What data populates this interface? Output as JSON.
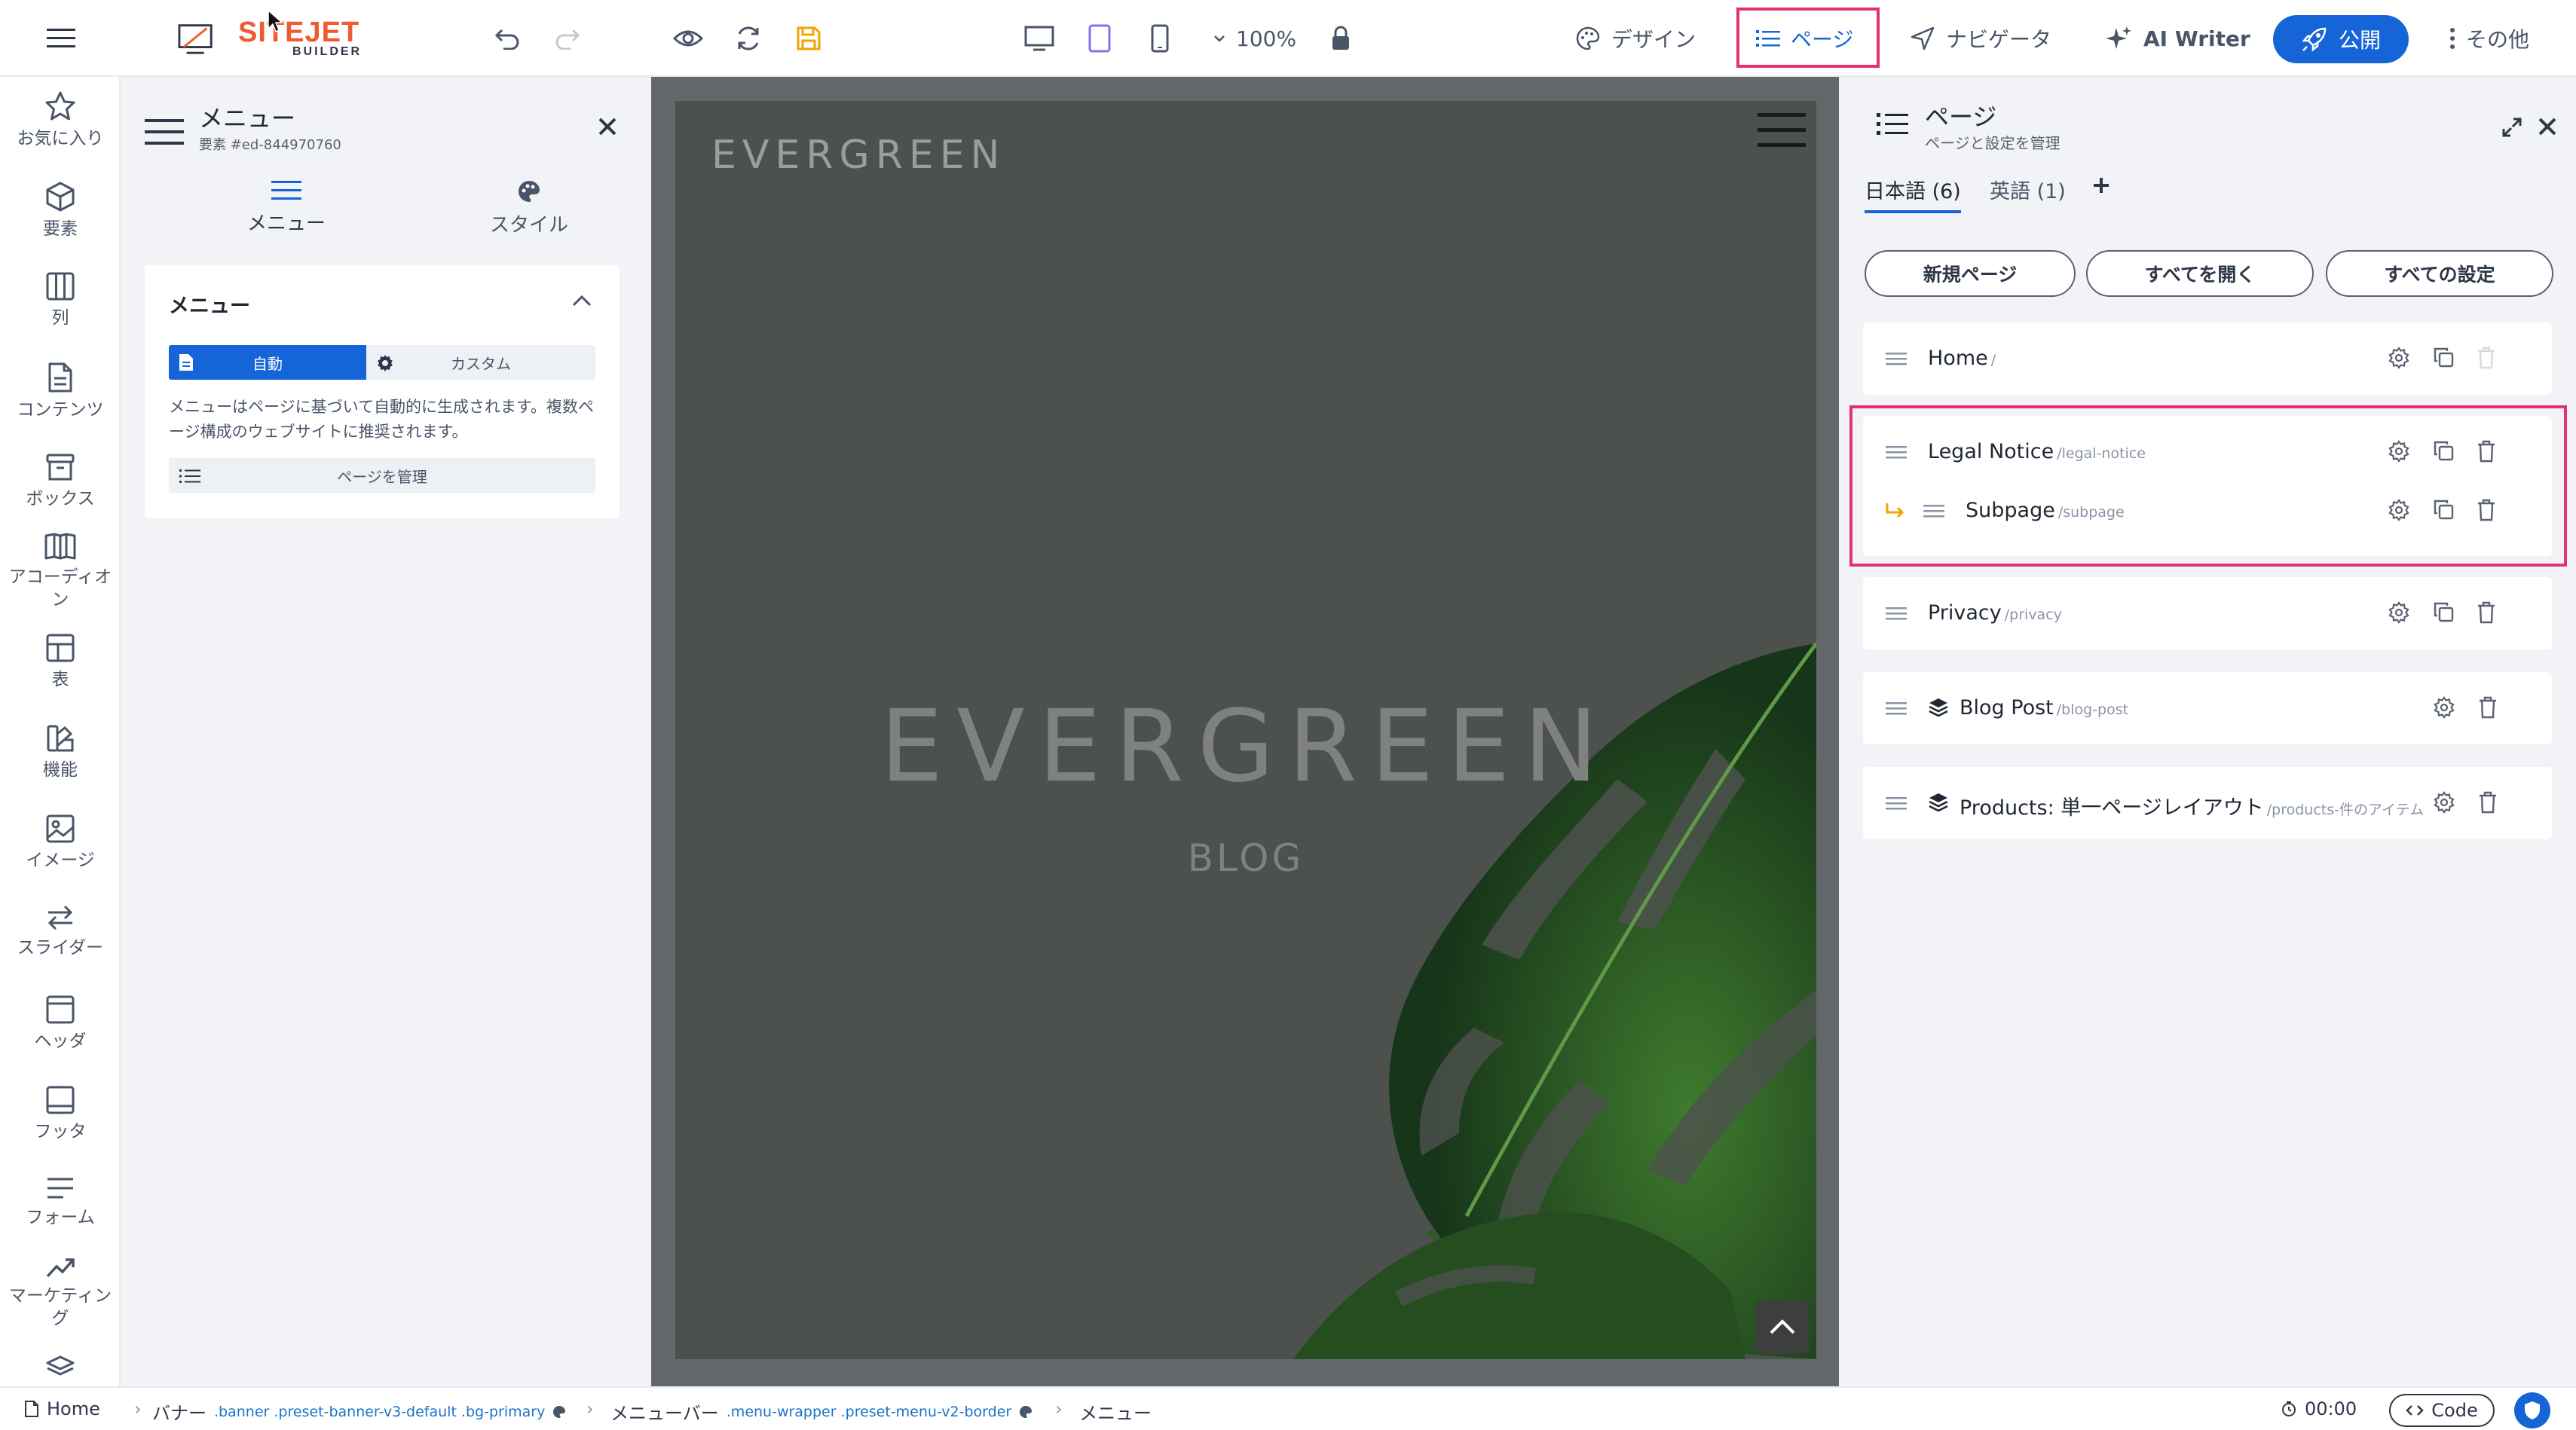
{
  "topbar": {
    "logo_main": "SITEJET",
    "logo_sub": "BUILDER",
    "zoom": "100%",
    "design": "デザイン",
    "pages": "ページ",
    "navigator": "ナビゲータ",
    "ai_writer": "AI Writer",
    "publish": "公開",
    "more": "その他"
  },
  "rail": [
    {
      "label": "お気に入り",
      "icon": "star-icon"
    },
    {
      "label": "要素",
      "icon": "cube-icon"
    },
    {
      "label": "列",
      "icon": "columns-icon"
    },
    {
      "label": "コンテンツ",
      "icon": "document-icon"
    },
    {
      "label": "ボックス",
      "icon": "box-icon"
    },
    {
      "label": "アコーディオン",
      "icon": "accordion-icon"
    },
    {
      "label": "表",
      "icon": "table-icon"
    },
    {
      "label": "機能",
      "icon": "feature-icon"
    },
    {
      "label": "イメージ",
      "icon": "image-icon"
    },
    {
      "label": "スライダー",
      "icon": "slider-icon"
    },
    {
      "label": "ヘッダ",
      "icon": "header-icon"
    },
    {
      "label": "フッタ",
      "icon": "footer-icon"
    },
    {
      "label": "フォーム",
      "icon": "form-icon"
    },
    {
      "label": "マーケティング",
      "icon": "marketing-icon"
    }
  ],
  "menu_panel": {
    "title": "メニュー",
    "element_id": "要素 #ed-844970760",
    "tab_menu": "メニュー",
    "tab_style": "スタイル",
    "section_title": "メニュー",
    "seg_auto": "自動",
    "seg_custom": "カスタム",
    "description": "メニューはページに基づいて自動的に生成されます。複数ページ構成のウェブサイトに推奨されます。",
    "manage_pages": "ページを管理"
  },
  "canvas": {
    "logo": "EVERGREEN",
    "hero_title": "EVERGREEN",
    "hero_sub": "BLOG"
  },
  "pages_panel": {
    "title": "ページ",
    "subtitle": "ページと設定を管理",
    "tab_ja": "日本語 (6)",
    "tab_en": "英語 (1)",
    "btn_new": "新規ページ",
    "btn_open_all": "すべてを開く",
    "btn_settings": "すべての設定",
    "pages": [
      {
        "name": "Home",
        "path": "/"
      },
      {
        "name": "Legal Notice",
        "path": "/legal-notice"
      },
      {
        "name": "Subpage",
        "path": "/subpage"
      },
      {
        "name": "Privacy",
        "path": "/privacy"
      },
      {
        "name": "Blog Post",
        "path": "/blog-post"
      },
      {
        "name": "Products: 単一ページレイアウト",
        "path": "/products-件のアイテム"
      }
    ]
  },
  "statusbar": {
    "home": "Home",
    "crumb_banner": "バナー",
    "banner_classes": ".banner .preset-banner-v3-default .bg-primary",
    "crumb_menubar": "メニューバー",
    "menubar_classes": ".menu-wrapper .preset-menu-v2-border",
    "crumb_menu": "メニュー",
    "timer": "00:00",
    "code": "Code"
  }
}
